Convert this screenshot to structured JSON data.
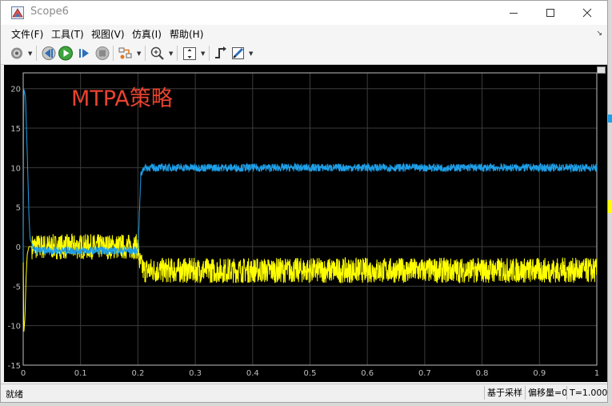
{
  "window": {
    "title": "Scope6"
  },
  "menubar": {
    "items": [
      "文件(F)",
      "工具(T)",
      "视图(V)",
      "仿真(I)",
      "帮助(H)"
    ]
  },
  "toolbar": {
    "icons": [
      "settings-icon",
      "step-back-icon",
      "run-icon",
      "step-forward-icon",
      "stop-icon",
      "highlight-icon",
      "zoom-icon",
      "autoscale-icon",
      "trigger-icon",
      "style-icon"
    ]
  },
  "plot": {
    "annotation": "MTPA策略",
    "annotation_color": "#e8432f",
    "background": "#000000",
    "grid_color": "#3c3c3c",
    "axis_color": "#bfbfbf",
    "series_colors": [
      "#1e9fe8",
      "#ffff00"
    ]
  },
  "chart_data": {
    "type": "line",
    "title": "",
    "xlabel": "",
    "ylabel": "",
    "xlim": [
      0,
      1
    ],
    "ylim": [
      -15,
      22
    ],
    "xticks": [
      "0",
      "0.1",
      "0.2",
      "0.3",
      "0.4",
      "0.5",
      "0.6",
      "0.7",
      "0.8",
      "0.9",
      "1"
    ],
    "yticks": [
      "20",
      "15",
      "10",
      "5",
      "0",
      "-5",
      "-10",
      "-15"
    ],
    "grid": true,
    "series": [
      {
        "color": "#1e9fe8",
        "x": [
          0,
          0.001,
          0.004,
          0.007,
          0.01,
          0.012,
          0.02,
          0.1,
          0.19,
          0.2,
          0.203,
          0.205,
          0.21,
          0.22,
          0.3,
          0.5,
          0.7,
          0.9,
          1.0
        ],
        "y": [
          -2,
          20,
          19,
          12,
          4,
          1,
          -0.5,
          -0.5,
          -0.5,
          -0.5,
          5,
          9,
          10,
          10,
          10,
          10,
          10,
          10,
          10
        ],
        "noise": 0.5
      },
      {
        "color": "#ffff00",
        "x": [
          0,
          0.001,
          0.003,
          0.005,
          0.007,
          0.01,
          0.02,
          0.1,
          0.2,
          0.203,
          0.21,
          0.3,
          0.5,
          0.7,
          0.9,
          1.0
        ],
        "y": [
          0,
          -11,
          -9,
          -4,
          -1,
          0,
          0,
          0,
          0,
          -2,
          -3,
          -3,
          -3,
          -3,
          -3,
          -3
        ],
        "noise": 1.6
      }
    ]
  },
  "statusbar": {
    "status": "就绪",
    "sample_mode": "基于采样",
    "offset": "偏移量=0",
    "time": "T=1.000"
  }
}
